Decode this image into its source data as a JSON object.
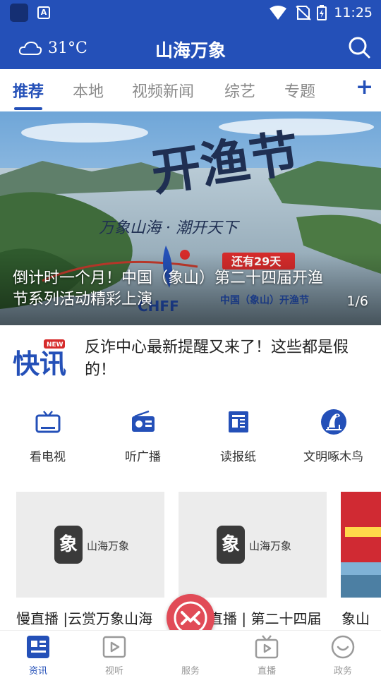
{
  "status_bar": {
    "time": "11:25",
    "app_icon_letter": "A"
  },
  "header": {
    "temperature": "31°C",
    "title": "山海万象"
  },
  "tabs": [
    {
      "label": "推荐"
    },
    {
      "label": "本地"
    },
    {
      "label": "视频新闻"
    },
    {
      "label": "综艺"
    },
    {
      "label": "专题"
    }
  ],
  "banner": {
    "caption": "倒计时一个月！中国（象山）第二十四届开渔节系列活动精彩上演",
    "counter": "1/6"
  },
  "flash_news": {
    "badge": "NEW",
    "logo_text": "快讯",
    "text": "反诈中心最新提醒又来了！这些都是假的！"
  },
  "quick_links": [
    {
      "label": "看电视",
      "icon": "tv-icon"
    },
    {
      "label": "听广播",
      "icon": "radio-icon"
    },
    {
      "label": "读报纸",
      "icon": "newspaper-icon"
    },
    {
      "label": "文明啄木鸟",
      "icon": "woodpecker-icon"
    }
  ],
  "cards": [
    {
      "title": "慢直播 |云赏万象山海",
      "placeholder_text": "山海万象",
      "logo_char": "象"
    },
    {
      "title": "直播 | 第二十四届",
      "placeholder_text": "山海万象",
      "logo_char": "象"
    },
    {
      "title": "象山"
    }
  ],
  "bottom_nav": [
    {
      "label": "资讯",
      "icon": "news-icon"
    },
    {
      "label": "视听",
      "icon": "video-icon"
    },
    {
      "label": "服务",
      "icon": "service-icon"
    },
    {
      "label": "直播",
      "icon": "live-tv-icon"
    },
    {
      "label": "政务",
      "icon": "government-icon"
    }
  ],
  "colors": {
    "brand": "#2450b8",
    "accent": "#e14b57",
    "status_bar": "#2450b8"
  }
}
